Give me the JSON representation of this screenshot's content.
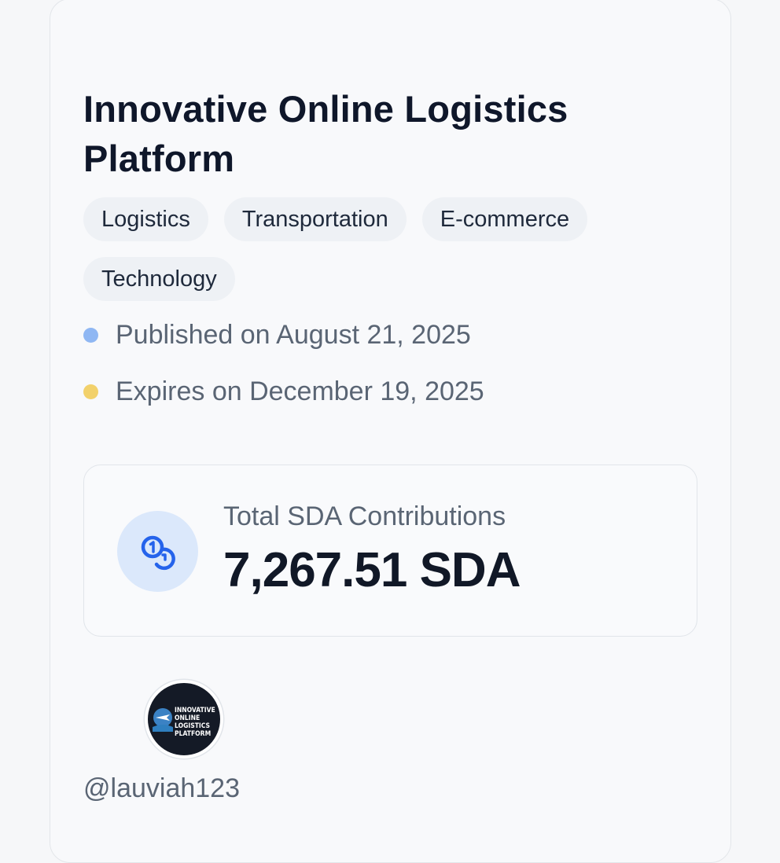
{
  "project": {
    "title": "Innovative Online Logistics Platform",
    "tags": [
      "Logistics",
      "Transportation",
      "E-commerce",
      "Technology"
    ],
    "published": "Published on August 21, 2025",
    "expires": "Expires on December 19, 2025"
  },
  "status_colors": {
    "published_dot": "#8fb7f3",
    "expires_dot": "#f2d16b"
  },
  "contributions": {
    "label": "Total SDA Contributions",
    "value": "7,267.51 SDA",
    "icon": "coins-icon",
    "icon_color": "#2563eb"
  },
  "creator": {
    "avatar_text": "INNOVATIVE\nONLINE\nLOGISTICS\nPLATFORM",
    "username": "@lauviah123"
  }
}
